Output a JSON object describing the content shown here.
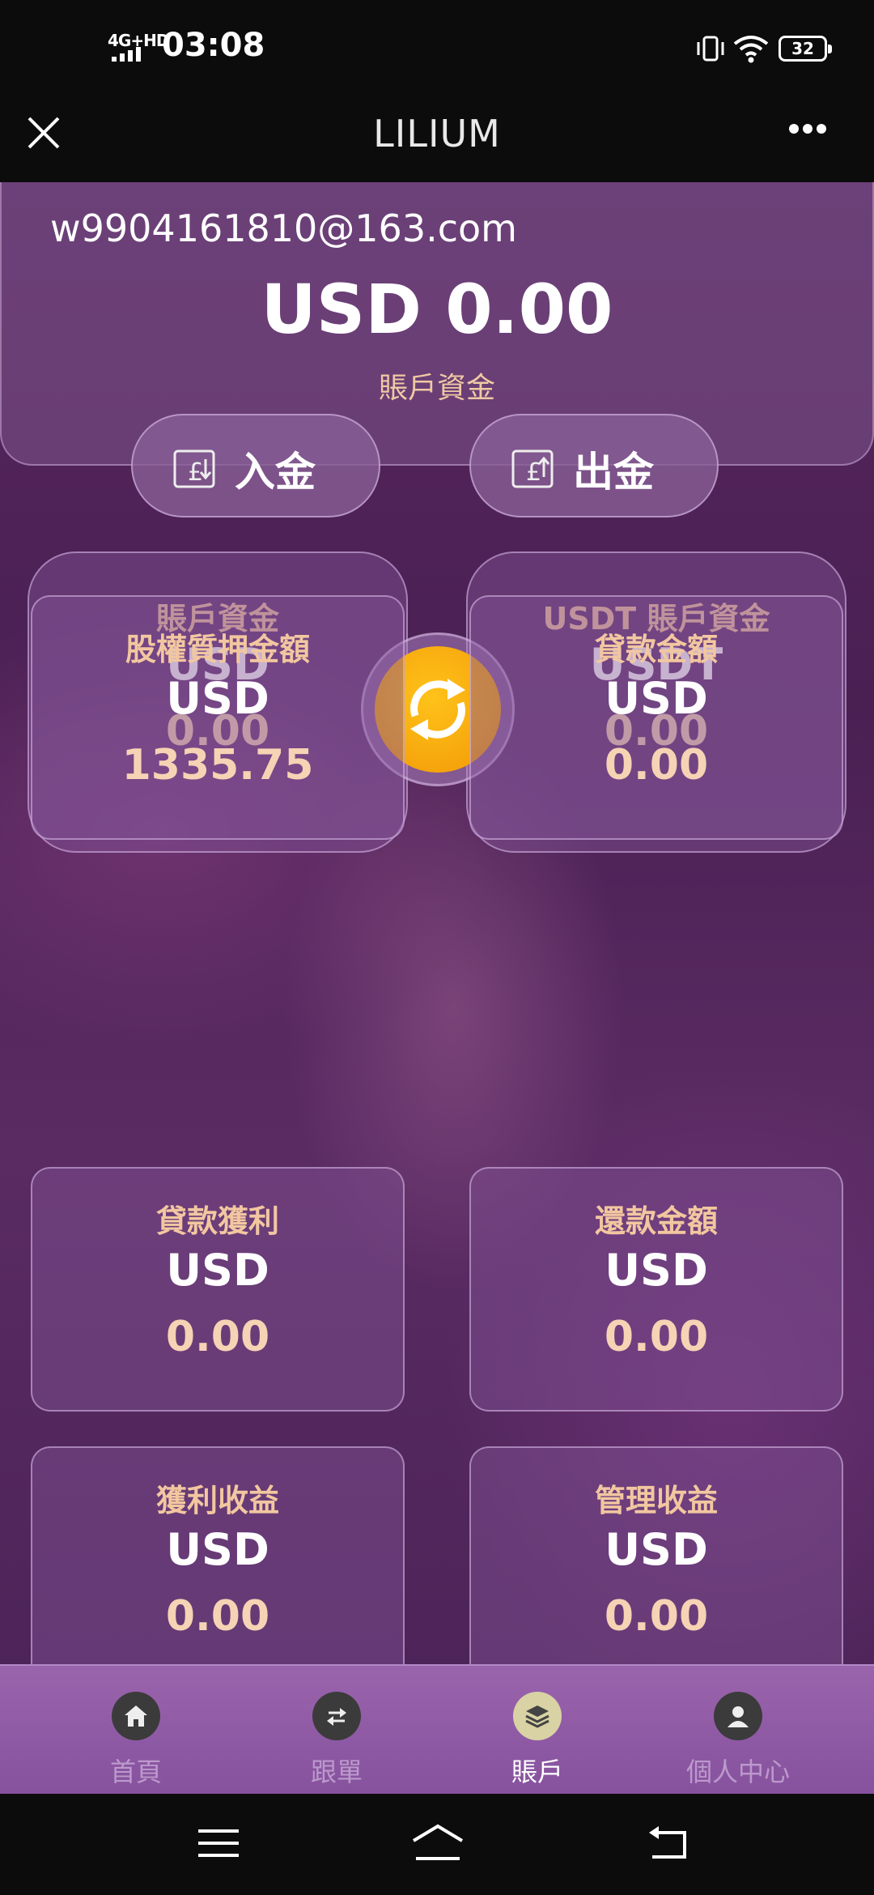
{
  "status_bar": {
    "network": "4G+HD",
    "time": "03:08",
    "battery": "32"
  },
  "title_bar": {
    "title": "LILIUM"
  },
  "account": {
    "email": "w9904161810@163.com",
    "balance": "USD 0.00",
    "balance_label": "賬戶資金"
  },
  "actions": {
    "deposit_label": "入金",
    "withdraw_label": "出金"
  },
  "wallets": [
    {
      "title": "賬戶資金",
      "currency": "USD",
      "value": "0.00"
    },
    {
      "title": "USDT 賬戶資金",
      "currency": "USDT",
      "value": "0.00"
    }
  ],
  "stats": [
    {
      "title": "股權質押金額",
      "currency": "USD",
      "value": "1335.75"
    },
    {
      "title": "貸款金額",
      "currency": "USD",
      "value": "0.00"
    },
    {
      "title": "貸款獲利",
      "currency": "USD",
      "value": "0.00"
    },
    {
      "title": "還款金額",
      "currency": "USD",
      "value": "0.00"
    },
    {
      "title": "獲利收益",
      "currency": "USD",
      "value": "0.00"
    },
    {
      "title": "管理收益",
      "currency": "USD",
      "value": "0.00"
    }
  ],
  "nav": {
    "items": [
      {
        "label": "首頁",
        "icon": "home-icon"
      },
      {
        "label": "跟單",
        "icon": "swap-icon"
      },
      {
        "label": "賬戶",
        "icon": "layers-icon",
        "active": true
      },
      {
        "label": "個人中心",
        "icon": "user-icon"
      }
    ]
  },
  "colors": {
    "accent_gold": "#f4a10a",
    "label_peach": "#f2c7a0",
    "background_purple": "#4a2053"
  }
}
